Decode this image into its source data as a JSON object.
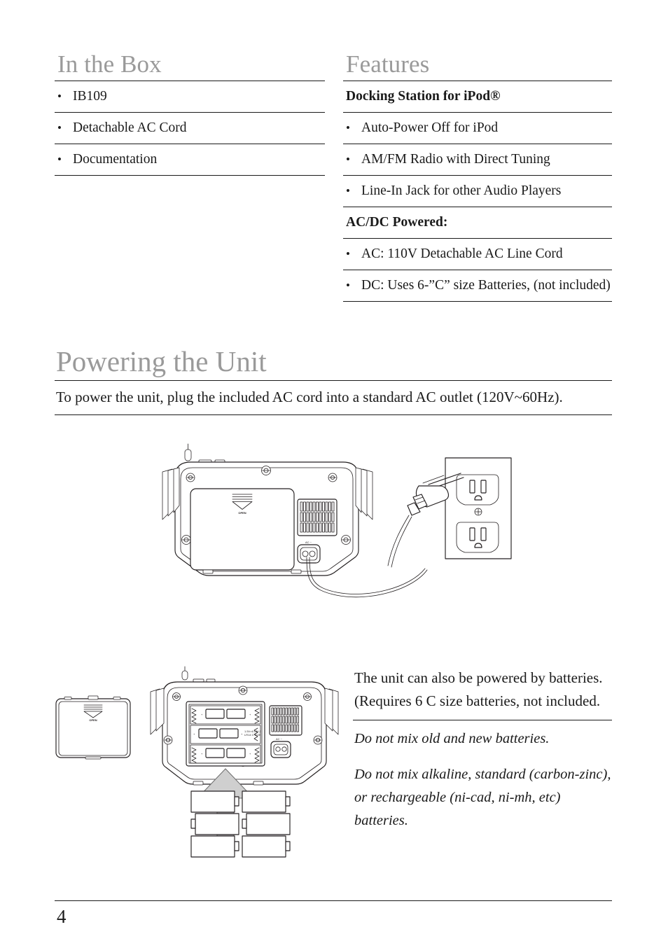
{
  "page": {
    "number": "4"
  },
  "in_the_box": {
    "heading": "In the Box",
    "items": [
      "IB109",
      "Detachable AC Cord",
      "Documentation"
    ]
  },
  "features": {
    "heading": "Features",
    "groups": [
      {
        "subhead": "Docking Station for iPod®",
        "items": [
          "Auto-Power Off for iPod",
          "AM/FM Radio with Direct Tuning",
          "Line-In Jack for other Audio Players"
        ]
      },
      {
        "subhead": "AC/DC Powered:",
        "items": [
          "AC: 110V Detachable AC Line Cord",
          "DC: Uses 6-”C” size Batteries, (not included)"
        ]
      }
    ]
  },
  "powering": {
    "heading": "Powering the Unit",
    "paragraph": "To power the unit, plug the included AC cord into a standard AC outlet (120V~60Hz)."
  },
  "battery_section": {
    "paragraph": "The unit can also be powered by batteries. (Requires 6 C size batteries, not included.",
    "note_1": "Do not mix old and new batteries.",
    "note_2": "Do not mix alkaline, standard (carbon-zinc), or rechargeable (ni-cad, ni-mh, etc) batteries."
  },
  "figures": {
    "ac_figure": {
      "name": "rear-of-unit-with-ac-cord-plugged-into-wall-outlet",
      "door_label": "OPEN",
      "ac_port_label": "AC ~"
    },
    "battery_figure": {
      "name": "battery-door-removed-and-six-c-cells-inserted",
      "door_label": "OPEN",
      "compartment_label": "1.5V×6 UM-2 LR14 C SIZE",
      "ac_port_label": "AC ~",
      "battery_count": 6
    }
  },
  "colors": {
    "heading_gray": "#9a9a9a",
    "text_black": "#1a1a1a",
    "rule_black": "#1a1a1a",
    "arrow_gray": "#cfcfcf",
    "line_art": "#231f20"
  }
}
